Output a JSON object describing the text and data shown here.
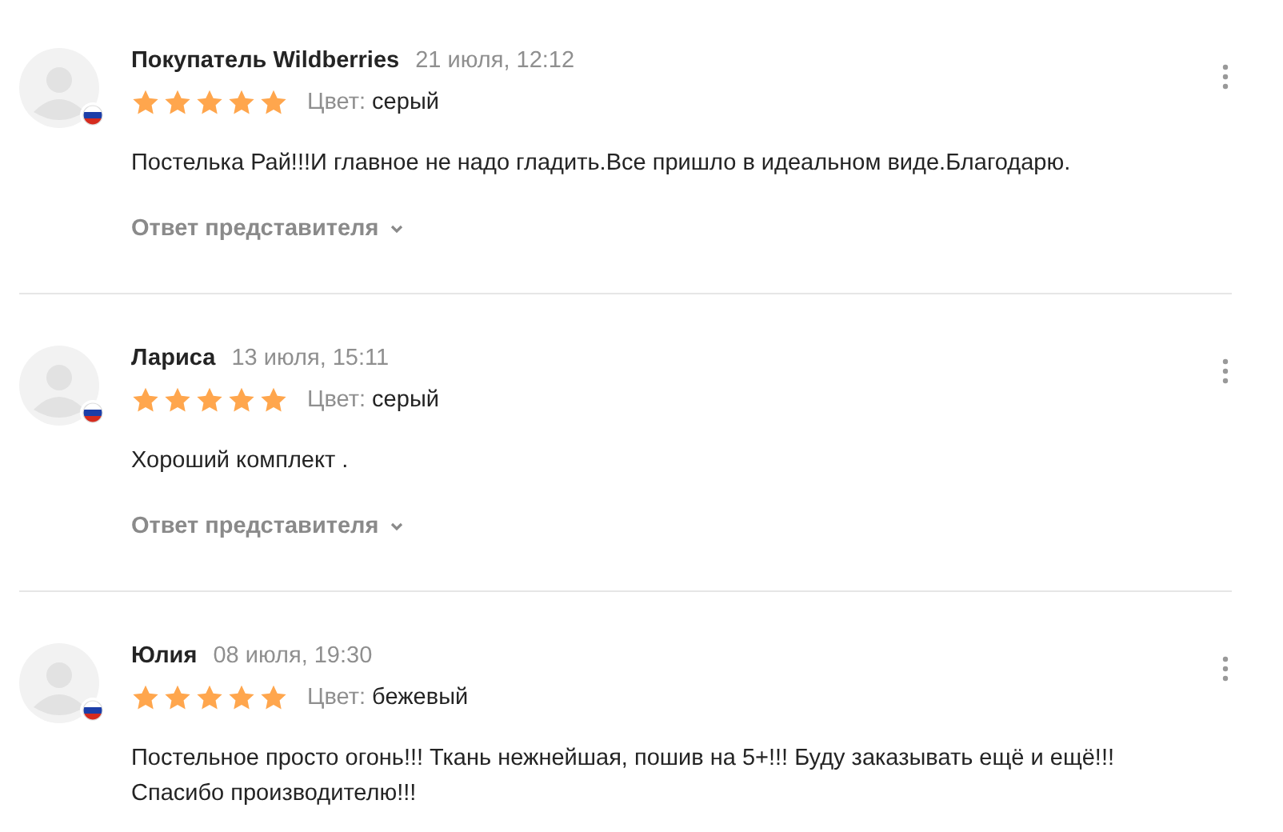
{
  "reviews": [
    {
      "author": "Покупатель Wildberries",
      "date": "21 июля, 12:12",
      "stars": 5,
      "attribute_label": "Цвет:",
      "attribute_value": "серый",
      "text": "Постелька Рай!!!И главное не надо гладить.Все пришло в идеальном виде.Благодарю.",
      "reply_label": "Ответ представителя"
    },
    {
      "author": "Лариса",
      "date": "13 июля, 15:11",
      "stars": 5,
      "attribute_label": "Цвет:",
      "attribute_value": "серый",
      "text": "Хороший комплект .",
      "reply_label": "Ответ представителя"
    },
    {
      "author": "Юлия",
      "date": "08 июля, 19:30",
      "stars": 5,
      "attribute_label": "Цвет:",
      "attribute_value": "бежевый",
      "text": "Постельное просто огонь!!! Ткань нежнейшая, пошив на 5+!!! Буду заказывать ещё и ещё!!! Спасибо производителю!!!"
    }
  ]
}
